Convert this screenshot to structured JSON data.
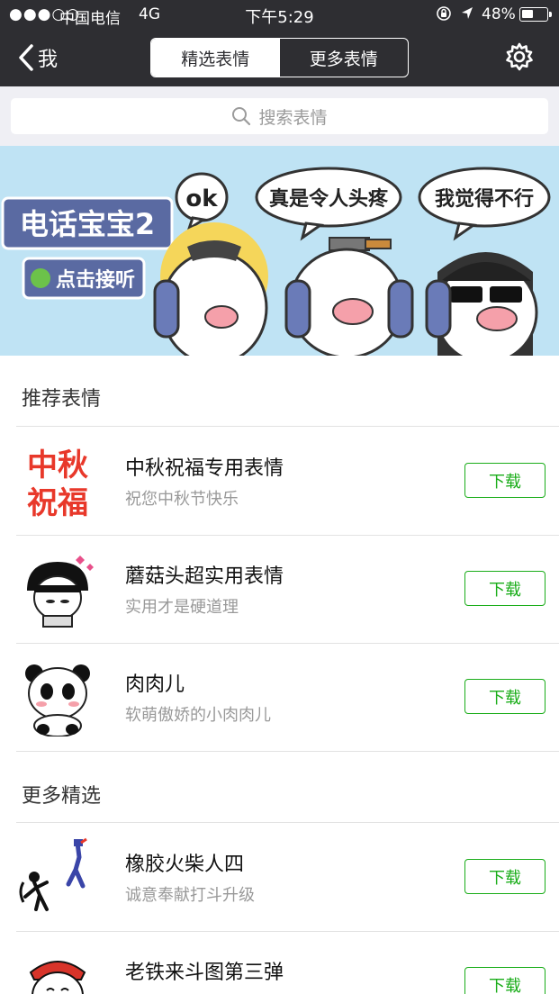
{
  "status_bar": {
    "signal": "●●●○○",
    "carrier": "中国电信",
    "network": "4G",
    "time": "下午5:29",
    "battery_percent": "48%",
    "battery_level": 0.48
  },
  "nav": {
    "back_label": "我",
    "tabs": [
      {
        "label": "精选表情",
        "active": true
      },
      {
        "label": "更多表情",
        "active": false
      }
    ]
  },
  "search": {
    "placeholder": "搜索表情"
  },
  "banner": {
    "title": "电话宝宝2",
    "call_label": "点击接听",
    "bubble_1": "ok",
    "bubble_2": "真是令人头疼",
    "bubble_3": "我觉得不行"
  },
  "sections": {
    "recommended_title": "推荐表情",
    "more_title": "更多精选"
  },
  "recommended": [
    {
      "name": "中秋祝福专用表情",
      "desc": "祝您中秋节快乐",
      "button": "下载",
      "thumb_text": "中秋\n祝福",
      "thumb_line1": "中秋",
      "thumb_line2": "祝福"
    },
    {
      "name": "蘑菇头超实用表情",
      "desc": "实用才是硬道理",
      "button": "下载"
    },
    {
      "name": "肉肉儿",
      "desc": "软萌傲娇的小肉肉儿",
      "button": "下载"
    }
  ],
  "more": [
    {
      "name": "橡胶火柴人四",
      "desc": "诚意奉献打斗升级",
      "button": "下载"
    },
    {
      "name": "老铁来斗图第三弹",
      "desc": "",
      "button": "下载"
    }
  ],
  "colors": {
    "nav_bg": "#2e2e32",
    "accent_green": "#1aad19",
    "banner_bg": "#bfe3f4",
    "search_bg": "#efeff4"
  }
}
